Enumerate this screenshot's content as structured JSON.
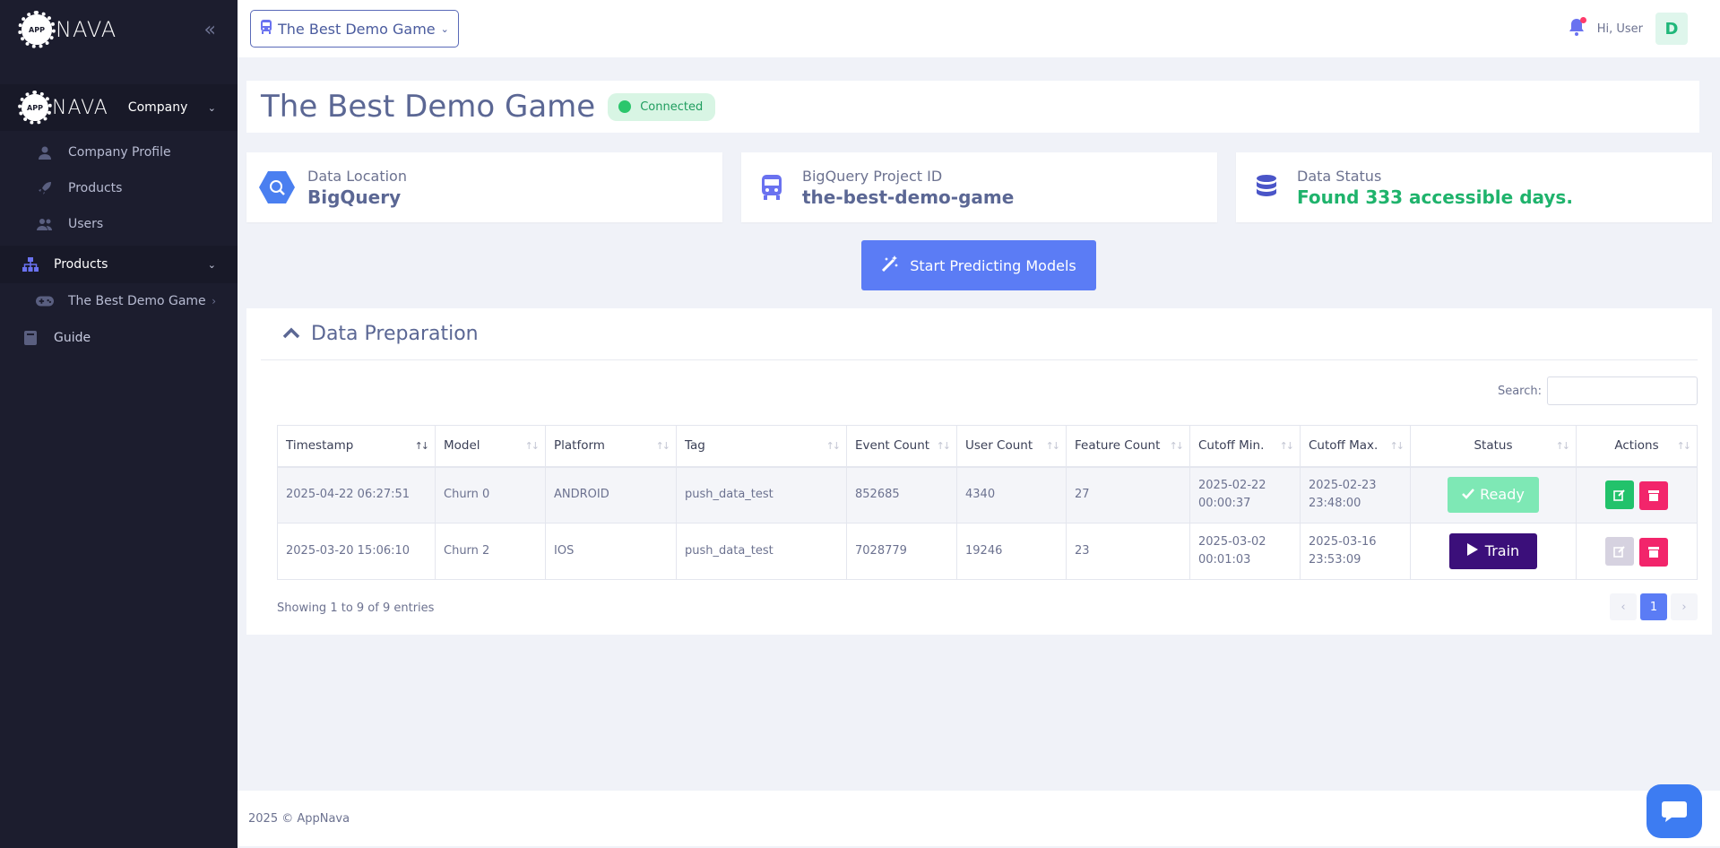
{
  "sidebar": {
    "logo_text": "NAVA",
    "logo_badge": "APP",
    "company_label": "Company",
    "company_items": [
      {
        "label": "Company Profile",
        "icon": "user-icon"
      },
      {
        "label": "Products",
        "icon": "rocket-icon"
      },
      {
        "label": "Users",
        "icon": "users-icon"
      }
    ],
    "products_label": "Products",
    "product_items": [
      {
        "label": "The Best Demo Game",
        "icon": "gamepad-icon"
      }
    ],
    "guide_label": "Guide"
  },
  "topbar": {
    "game_select": "The Best Demo Game",
    "greeting": "Hi, User",
    "avatar_initial": "D"
  },
  "page": {
    "title": "The Best Demo Game",
    "connection_status": "Connected"
  },
  "info_cards": [
    {
      "label": "Data Location",
      "value": "BigQuery"
    },
    {
      "label": "BigQuery Project ID",
      "value": "the-best-demo-game"
    },
    {
      "label": "Data Status",
      "value": "Found 333 accessible days."
    }
  ],
  "start_button": "Start Predicting Models",
  "data_prep": {
    "title": "Data Preparation",
    "search_label": "Search:",
    "columns": [
      "Timestamp",
      "Model",
      "Platform",
      "Tag",
      "Event Count",
      "User Count",
      "Feature Count",
      "Cutoff Min.",
      "Cutoff Max.",
      "Status",
      "Actions"
    ],
    "rows": [
      {
        "timestamp": "2025-04-22 06:27:51",
        "model": "Churn 0",
        "platform": "ANDROID",
        "tag": "push_data_test",
        "event_count": "852685",
        "user_count": "4340",
        "feature_count": "27",
        "cutoff_min_date": "2025-02-22",
        "cutoff_min_time": "00:00:37",
        "cutoff_max_date": "2025-02-23",
        "cutoff_max_time": "23:48:00",
        "status": "Ready"
      },
      {
        "timestamp": "2025-03-20 15:06:10",
        "model": "Churn 2",
        "platform": "IOS",
        "tag": "push_data_test",
        "event_count": "7028779",
        "user_count": "19246",
        "feature_count": "23",
        "cutoff_min_date": "2025-03-02",
        "cutoff_min_time": "00:01:03",
        "cutoff_max_date": "2025-03-16",
        "cutoff_max_time": "23:53:09",
        "status": "Train"
      }
    ],
    "showing": "Showing 1 to 9 of 9 entries",
    "pages": {
      "prev": "‹",
      "current": "1",
      "next": "›"
    }
  },
  "footer": "2025 © AppNava",
  "colors": {
    "sidebar_bg": "#1c1d2e",
    "accent": "#5b7cf5",
    "success": "#1fb36c",
    "train": "#3b0f7a",
    "danger": "#f2256b"
  }
}
